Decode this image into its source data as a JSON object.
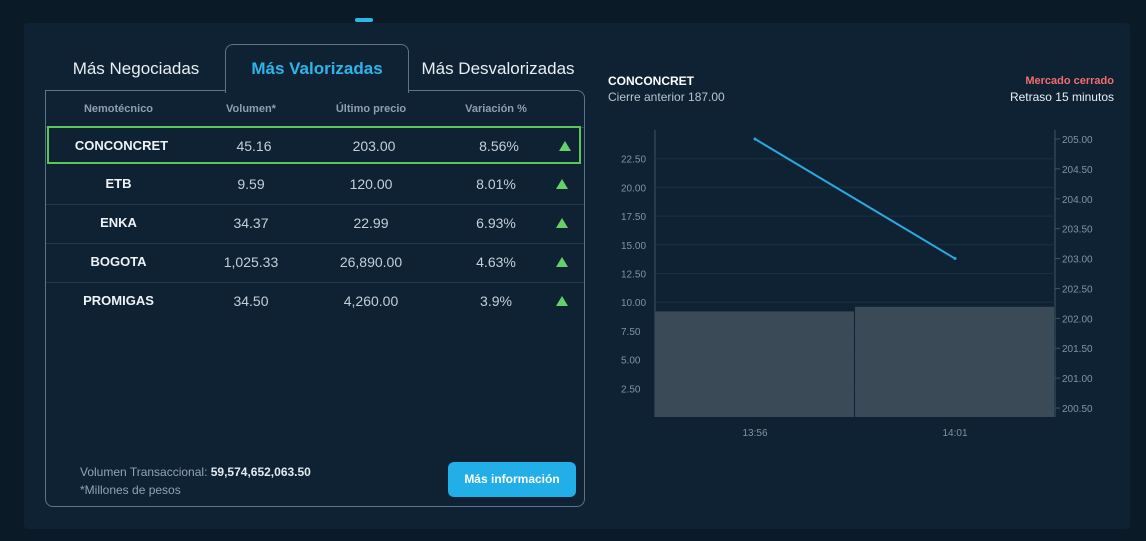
{
  "tabs": [
    {
      "label": "Más Negociadas",
      "active": false
    },
    {
      "label": "Más Valorizadas",
      "active": true
    },
    {
      "label": "Más Desvalorizadas",
      "active": false
    }
  ],
  "table": {
    "headers": [
      "Nemotécnico",
      "Volumen*",
      "Último precio",
      "Variación %"
    ],
    "rows": [
      {
        "ticker": "CONCONCRET",
        "volume": "45.16",
        "last_price": "203.00",
        "variation": "8.56%",
        "direction": "up-icon"
      },
      {
        "ticker": "ETB",
        "volume": "9.59",
        "last_price": "120.00",
        "variation": "8.01%",
        "direction": "up-icon"
      },
      {
        "ticker": "ENKA",
        "volume": "34.37",
        "last_price": "22.99",
        "variation": "6.93%",
        "direction": "up-icon"
      },
      {
        "ticker": "BOGOTA",
        "volume": "1,025.33",
        "last_price": "26,890.00",
        "variation": "4.63%",
        "direction": "up-icon"
      },
      {
        "ticker": "PROMIGAS",
        "volume": "34.50",
        "last_price": "4,260.00",
        "variation": "3.9%",
        "direction": "up-icon"
      }
    ]
  },
  "footer": {
    "volume_label": "Volumen Transaccional:",
    "volume_value": "59,574,652,063.50",
    "note": "*Millones de pesos",
    "more_button": "Más información"
  },
  "detail": {
    "ticker": "CONCONCRET",
    "previous_close": "Cierre anterior 187.00",
    "market_status": "Mercado cerrado",
    "delay": "Retraso 15 minutos"
  },
  "colors": {
    "accent": "#22aee6",
    "up": "#67cf6a",
    "selected_border": "#5ec55a",
    "closed": "#f26d6d",
    "volume_bars": "#3a4b57",
    "price_line": "#2aa9dd"
  },
  "chart_data": {
    "type": "bar",
    "x_categories": [
      "13:56",
      "14:01"
    ],
    "volume": {
      "values": [
        9.2,
        9.6
      ],
      "axis_ticks": [
        "22.50",
        "20.00",
        "17.50",
        "15.00",
        "12.50",
        "10.00",
        "7.50",
        "5.00",
        "2.50"
      ],
      "ylim": [
        0,
        25
      ]
    },
    "price": {
      "type": "line",
      "values": [
        205.0,
        203.0
      ],
      "axis_ticks": [
        "205.00",
        "204.50",
        "204.00",
        "203.50",
        "203.00",
        "202.50",
        "202.00",
        "201.50",
        "201.00",
        "200.50"
      ],
      "ylim": [
        200.35,
        205.15
      ]
    },
    "grid": true,
    "legend": "none"
  }
}
